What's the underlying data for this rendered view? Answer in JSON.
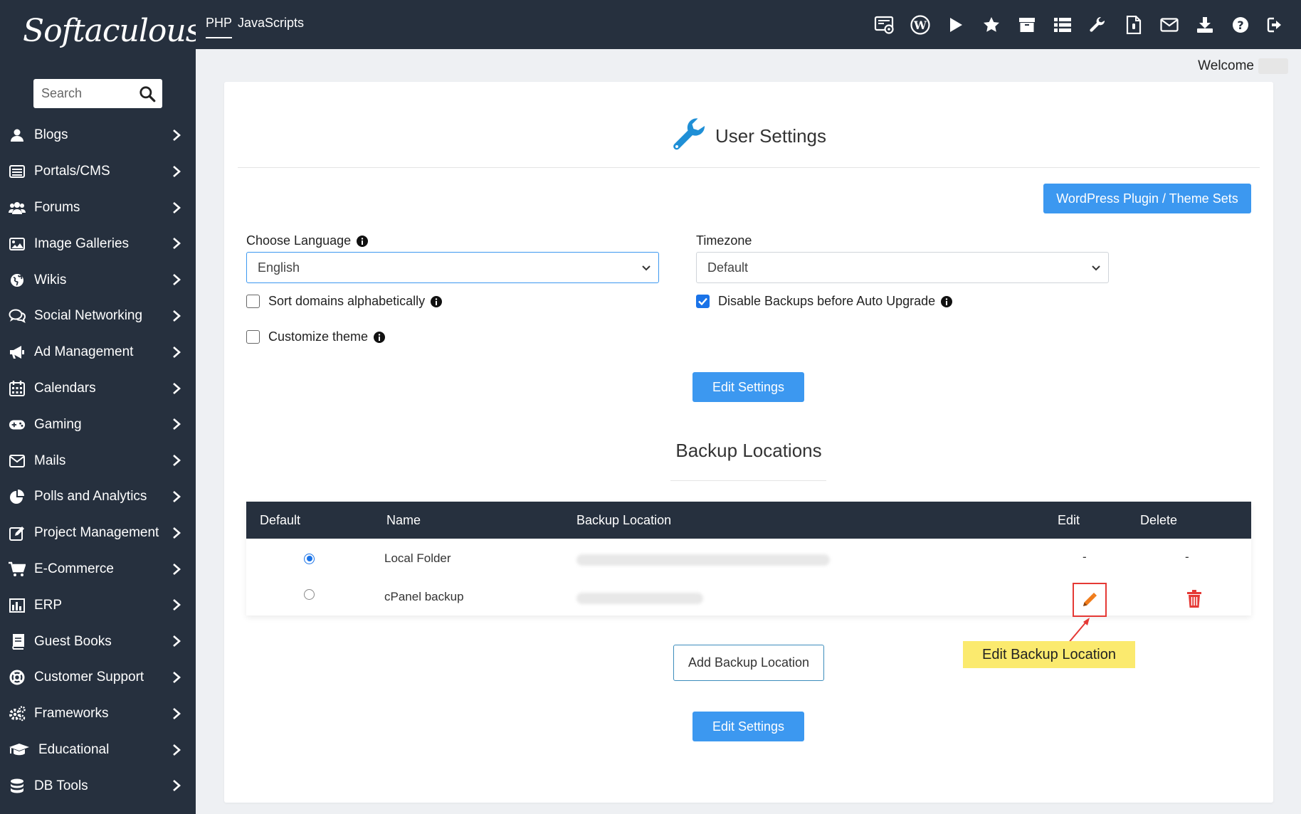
{
  "app": {
    "logo_text": "Softaculous"
  },
  "search": {
    "placeholder": "Search"
  },
  "sidebar": {
    "items": [
      {
        "label": "Blogs",
        "icon": "user-icon"
      },
      {
        "label": "Portals/CMS",
        "icon": "list-icon"
      },
      {
        "label": "Forums",
        "icon": "users-icon"
      },
      {
        "label": "Image Galleries",
        "icon": "image-icon"
      },
      {
        "label": "Wikis",
        "icon": "globe-icon"
      },
      {
        "label": "Social Networking",
        "icon": "comments-icon"
      },
      {
        "label": "Ad Management",
        "icon": "bullhorn-icon"
      },
      {
        "label": "Calendars",
        "icon": "calendar-icon"
      },
      {
        "label": "Gaming",
        "icon": "gamepad-icon"
      },
      {
        "label": "Mails",
        "icon": "envelope-icon"
      },
      {
        "label": "Polls and Analytics",
        "icon": "pie-chart-icon"
      },
      {
        "label": "Project Management",
        "icon": "edit-icon"
      },
      {
        "label": "E-Commerce",
        "icon": "cart-icon"
      },
      {
        "label": "ERP",
        "icon": "bar-chart-icon"
      },
      {
        "label": "Guest Books",
        "icon": "book-icon"
      },
      {
        "label": "Customer Support",
        "icon": "life-ring-icon"
      },
      {
        "label": "Frameworks",
        "icon": "cogs-icon"
      },
      {
        "label": "Educational",
        "icon": "graduation-cap-icon"
      },
      {
        "label": "DB Tools",
        "icon": "database-icon"
      }
    ]
  },
  "topbar": {
    "tabs": [
      "PHP",
      "JavaScripts"
    ],
    "icons": [
      "installations-icon",
      "wordpress-icon",
      "play-icon",
      "star-icon",
      "archive-icon",
      "list-icon",
      "wrench-icon",
      "file-icon",
      "envelope-icon",
      "download-icon",
      "help-icon",
      "logout-icon"
    ]
  },
  "welcome": {
    "text": "Welcome"
  },
  "settings": {
    "title": "User Settings",
    "wp_sets_label": "WordPress Plugin / Theme Sets",
    "language_label": "Choose Language",
    "language_value": "English",
    "timezone_label": "Timezone",
    "timezone_value": "Default",
    "sort_domains_label": "Sort domains alphabetically",
    "sort_domains_checked": false,
    "disable_backups_label": "Disable Backups before Auto Upgrade",
    "disable_backups_checked": true,
    "customize_theme_label": "Customize theme",
    "customize_theme_checked": false,
    "edit_button_label": "Edit Settings"
  },
  "backups": {
    "heading": "Backup Locations",
    "columns": [
      "Default",
      "Name",
      "Backup Location",
      "Edit",
      "Delete"
    ],
    "rows": [
      {
        "default": true,
        "name": "Local Folder",
        "edit": "-",
        "delete": "-"
      },
      {
        "default": false,
        "name": "cPanel backup",
        "edit": "",
        "delete": ""
      }
    ],
    "add_button_label": "Add Backup Location",
    "edit_button_label": "Edit Settings"
  },
  "annotation": {
    "label": "Edit Backup Location",
    "color": "#fbea6e"
  },
  "colors": {
    "sidebar": "#26303e",
    "accent": "#3c98f0",
    "danger": "#e53935"
  }
}
